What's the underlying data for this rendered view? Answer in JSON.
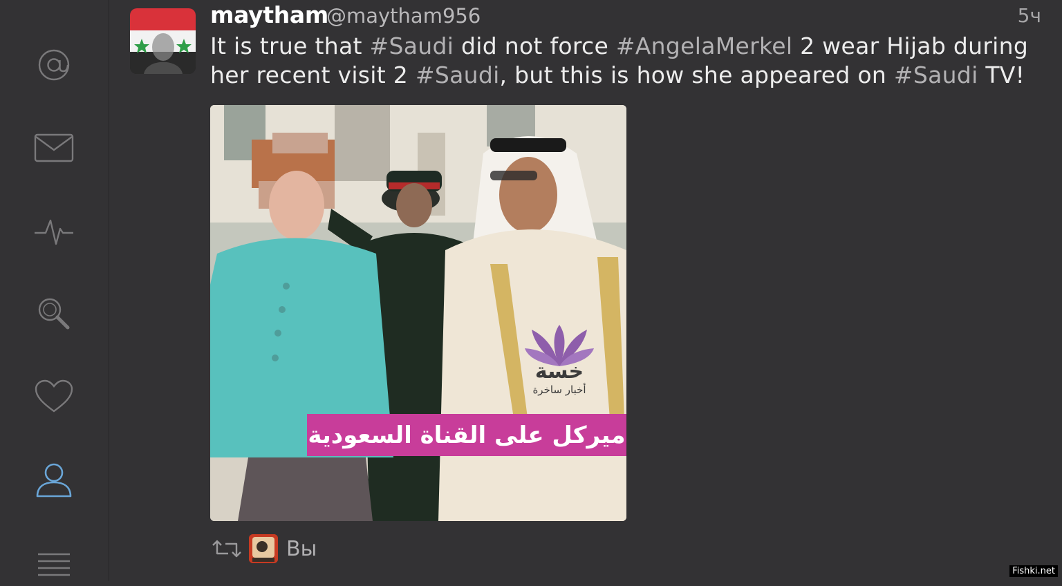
{
  "sidebar": {
    "items": [
      {
        "icon": "at-icon",
        "selected": false
      },
      {
        "icon": "mail-icon",
        "selected": false
      },
      {
        "icon": "activity-icon",
        "selected": false
      },
      {
        "icon": "search-icon",
        "selected": false
      },
      {
        "icon": "heart-icon",
        "selected": false
      },
      {
        "icon": "profile-icon",
        "selected": true
      },
      {
        "icon": "menu-icon",
        "selected": false
      }
    ],
    "accent_color": "#6aa6d8",
    "icon_color": "#7a797b"
  },
  "tweet": {
    "name": "maytham",
    "handle": "@maytham956",
    "time": "5ч",
    "text_parts": [
      {
        "t": "It is true that ",
        "tag": false
      },
      {
        "t": "#Saudi",
        "tag": true
      },
      {
        "t": " did not force ",
        "tag": false
      },
      {
        "t": "#AngelaMerkel",
        "tag": true
      },
      {
        "t": " 2 wear Hijab during her recent visit 2 ",
        "tag": false
      },
      {
        "t": "#Saudi",
        "tag": true
      },
      {
        "t": ", but this is how she appeared on ",
        "tag": false
      },
      {
        "t": "#Saudi",
        "tag": true
      },
      {
        "t": " TV!",
        "tag": false
      }
    ],
    "media": {
      "caption": "ميركل على القناة السعودية",
      "logo_title": "خسة",
      "logo_subtitle": "أخبار ساخرة",
      "caption_color": "#c83d9a"
    },
    "retweeted_by": "Вы"
  },
  "watermark": "Fishki.net"
}
